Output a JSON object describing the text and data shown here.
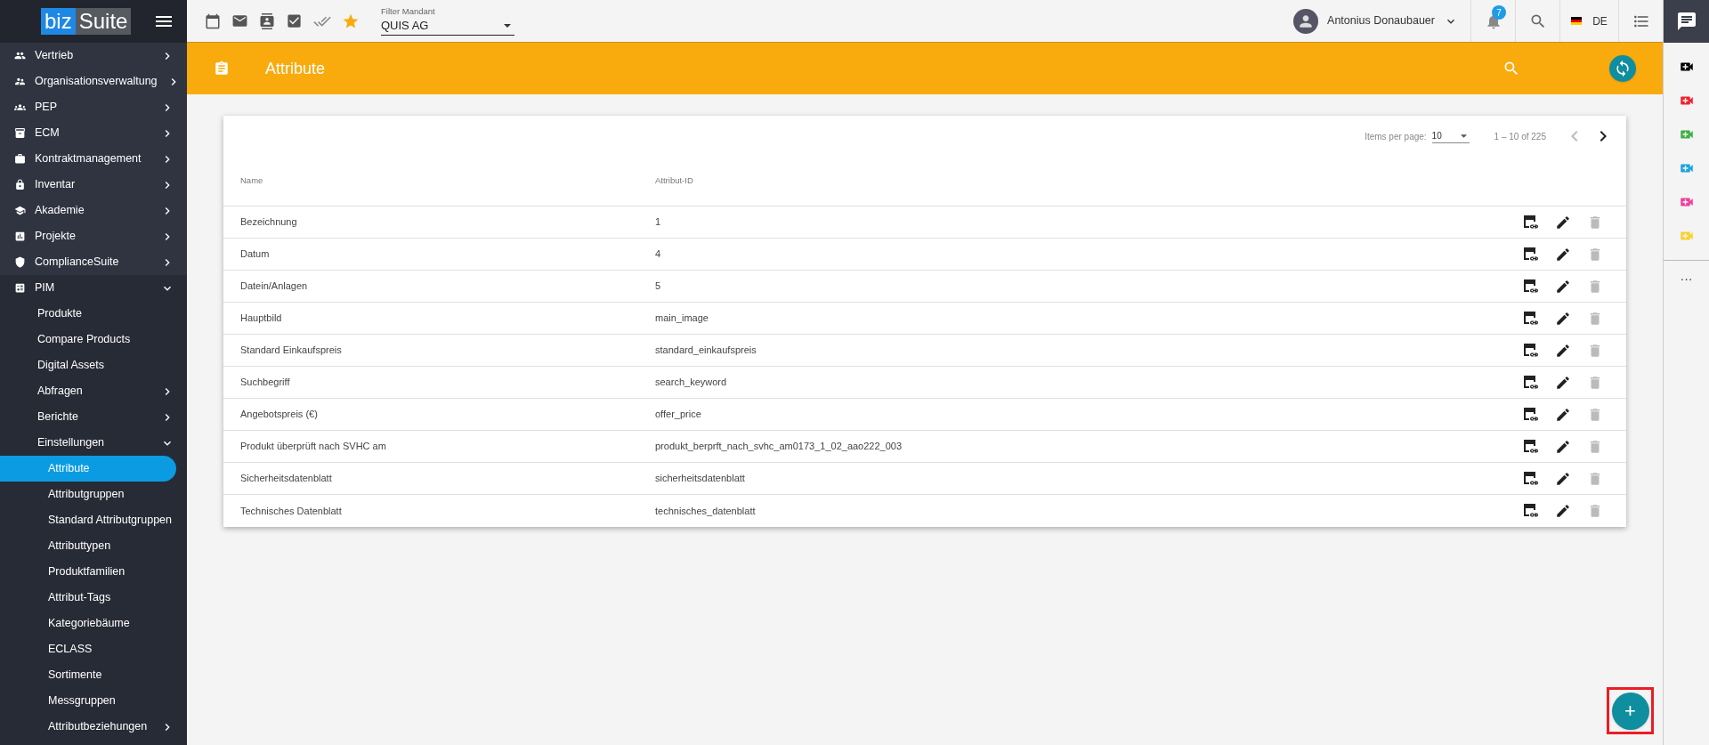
{
  "logo": {
    "part_1": "biz",
    "part_2": "Suite"
  },
  "sidebar": {
    "items": [
      {
        "label": "Vertrieb",
        "expanded": false
      },
      {
        "label": "Organisationsverwaltung",
        "expanded": false
      },
      {
        "label": "PEP",
        "expanded": false
      },
      {
        "label": "ECM",
        "expanded": false
      },
      {
        "label": "Kontraktmanagement",
        "expanded": false
      },
      {
        "label": "Inventar",
        "expanded": false
      },
      {
        "label": "Akademie",
        "expanded": false
      },
      {
        "label": "Projekte",
        "expanded": false
      },
      {
        "label": "ComplianceSuite",
        "expanded": false
      },
      {
        "label": "PIM",
        "expanded": true,
        "children": [
          {
            "label": "Produkte",
            "selected": false
          },
          {
            "label": "Compare Products",
            "selected": false
          },
          {
            "label": "Digital Assets",
            "selected": false
          },
          {
            "label": "Abfragen",
            "expanded": false,
            "selected": false
          },
          {
            "label": "Berichte",
            "expanded": false,
            "selected": false
          },
          {
            "label": "Einstellungen",
            "expanded": true,
            "selected": false,
            "children": [
              {
                "label": "Attribute",
                "selected": true
              },
              {
                "label": "Attributgruppen",
                "selected": false
              },
              {
                "label": "Standard Attributgruppen",
                "selected": false
              },
              {
                "label": "Attributtypen",
                "selected": false
              },
              {
                "label": "Produktfamilien",
                "selected": false
              },
              {
                "label": "Attribut-Tags",
                "selected": false
              },
              {
                "label": "Kategoriebäume",
                "selected": false
              },
              {
                "label": "ECLASS",
                "selected": false
              },
              {
                "label": "Sortimente",
                "selected": false
              },
              {
                "label": "Messgruppen",
                "selected": false
              },
              {
                "label": "Attributbeziehungen",
                "selected": false,
                "expanded": false
              }
            ]
          }
        ]
      }
    ]
  },
  "topbar": {
    "filter": {
      "label": "Filter Mandant",
      "value": "QUIS AG"
    },
    "user": {
      "name": "Antonius Donaubauer"
    },
    "notifications": {
      "count": "7"
    },
    "language": "DE"
  },
  "header": {
    "title": "Attribute"
  },
  "table": {
    "pagination": {
      "items_per_page_label": "Items per page:",
      "items_per_page": "10",
      "range": "1 – 10 of 225",
      "prev_enabled": false,
      "next_enabled": true
    },
    "columns": [
      "Name",
      "Attribut-ID"
    ],
    "rows": [
      {
        "name": "Bezeichnung",
        "id": "1"
      },
      {
        "name": "Datum",
        "id": "4"
      },
      {
        "name": "Datein/Anlagen",
        "id": "5"
      },
      {
        "name": "Hauptbild",
        "id": "main_image"
      },
      {
        "name": "Standard Einkaufspreis",
        "id": "standard_einkaufspreis"
      },
      {
        "name": "Suchbegriff",
        "id": "search_keyword"
      },
      {
        "name": "Angebotspreis (€)",
        "id": "offer_price"
      },
      {
        "name": "Produkt überprüft nach SVHC am",
        "id": "produkt_berprft_nach_svhc_am0173_1_02_aao222_003"
      },
      {
        "name": "Sicherheitsdatenblatt",
        "id": "sicherheitsdatenblatt"
      },
      {
        "name": "Technisches Datenblatt",
        "id": "technisches_datenblatt"
      }
    ]
  },
  "rail": {
    "items": [
      {
        "color": "#000000"
      },
      {
        "color": "#f0202a"
      },
      {
        "color": "#3cb043"
      },
      {
        "color": "#1aa3e0"
      },
      {
        "color": "#f23c9c"
      },
      {
        "color": "#fad02c"
      }
    ],
    "more": "···"
  },
  "fab": {
    "label": "+",
    "highlighted": true
  }
}
